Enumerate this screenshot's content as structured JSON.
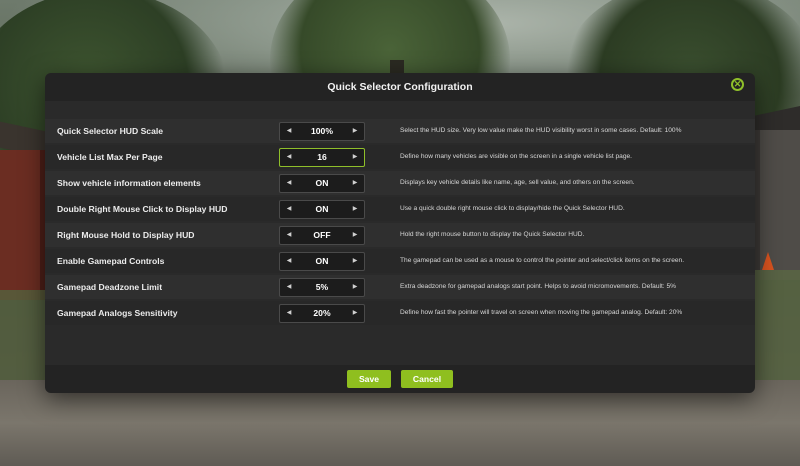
{
  "dialog": {
    "title": "Quick Selector Configuration",
    "close_icon": "close-circle-icon",
    "accent_color": "#8fbf1f"
  },
  "settings": [
    {
      "label": "Quick Selector HUD Scale",
      "value": "100%",
      "description": "Select the HUD size. Very low value make the HUD visibility worst in some cases. Default: 100%"
    },
    {
      "label": "Vehicle List Max Per Page",
      "value": "16",
      "description": "Define how many vehicles are visible on the screen in a single vehicle list page."
    },
    {
      "label": "Show vehicle information elements",
      "value": "ON",
      "description": "Displays key vehicle details like name, age, sell value, and others on the screen."
    },
    {
      "label": "Double Right Mouse Click to Display HUD",
      "value": "ON",
      "description": "Use a quick double right mouse click to display/hide the Quick Selector HUD."
    },
    {
      "label": "Right Mouse Hold to Display HUD",
      "value": "OFF",
      "description": "Hold the right mouse button to display the Quick Selector HUD."
    },
    {
      "label": "Enable Gamepad Controls",
      "value": "ON",
      "description": "The gamepad can be used as a mouse to control the pointer and select/click items on the screen."
    },
    {
      "label": "Gamepad Deadzone Limit",
      "value": "5%",
      "description": "Extra deadzone for gamepad analogs start point. Helps to avoid micromovements. Default: 5%"
    },
    {
      "label": "Gamepad Analogs Sensitivity",
      "value": "20%",
      "description": "Define how fast the pointer will travel on screen when moving the gamepad analog. Default: 20%"
    }
  ],
  "stepper": {
    "left_icon": "arrow-left-icon",
    "right_icon": "arrow-right-icon",
    "left_glyph": "◀",
    "right_glyph": "▶"
  },
  "buttons": {
    "save": "Save",
    "cancel": "Cancel"
  }
}
